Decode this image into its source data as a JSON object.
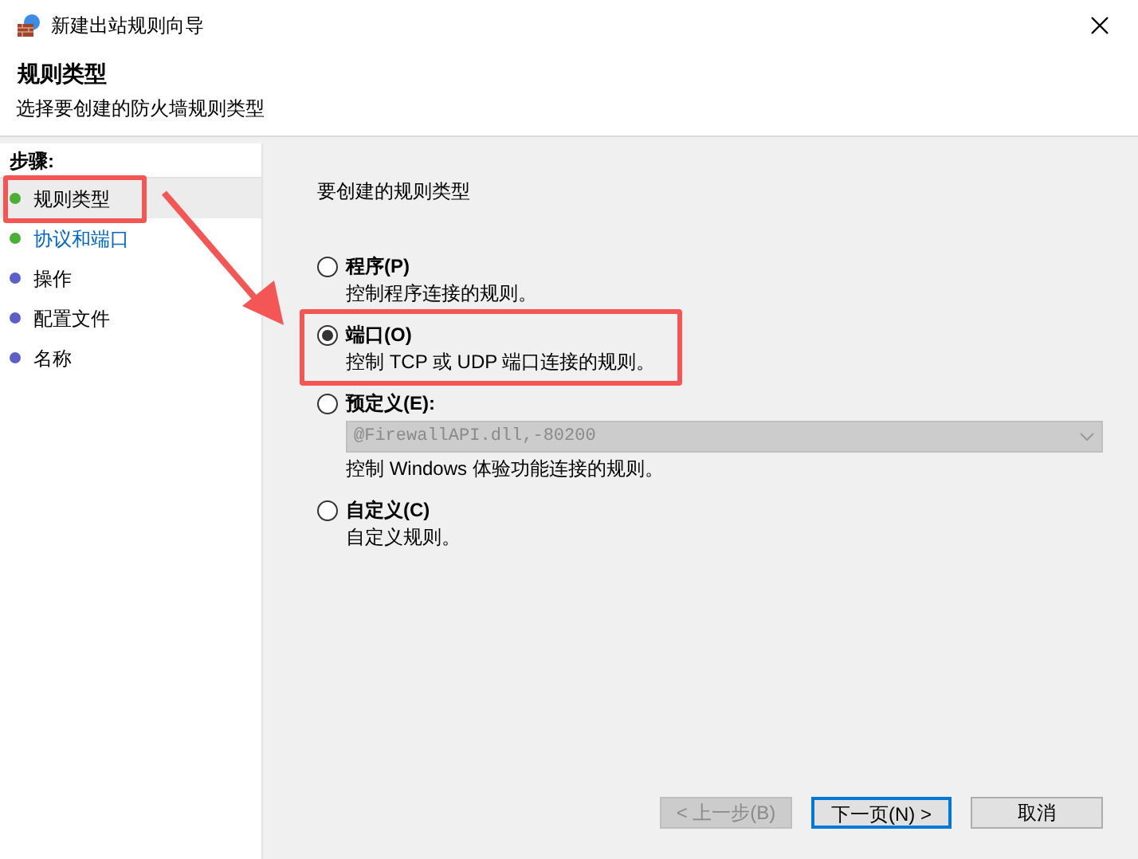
{
  "window": {
    "title": "新建出站规则向导"
  },
  "header": {
    "title": "规则类型",
    "subtitle": "选择要创建的防火墙规则类型"
  },
  "steps": {
    "title": "步骤:",
    "items": [
      {
        "label": "规则类型",
        "selected": true,
        "link": false,
        "color": "#4caf35"
      },
      {
        "label": "协议和端口",
        "selected": false,
        "link": true,
        "color": "#4caf35"
      },
      {
        "label": "操作",
        "selected": false,
        "link": false,
        "color": "#5b5fc7"
      },
      {
        "label": "配置文件",
        "selected": false,
        "link": false,
        "color": "#5b5fc7"
      },
      {
        "label": "名称",
        "selected": false,
        "link": false,
        "color": "#5b5fc7"
      }
    ]
  },
  "prompt": "要创建的规则类型",
  "options": [
    {
      "label": "程序(P)",
      "description": "控制程序连接的规则。",
      "selected": false
    },
    {
      "label": "端口(O)",
      "description": "控制 TCP 或 UDP 端口连接的规则。",
      "selected": true
    },
    {
      "label": "预定义(E):",
      "description": "控制 Windows 体验功能连接的规则。",
      "selected": false,
      "dropdown": {
        "value": "@FirewallAPI.dll,-80200",
        "disabled": true
      }
    },
    {
      "label": "自定义(C)",
      "description": "自定义规则。",
      "selected": false
    }
  ],
  "buttons": [
    {
      "label": "< 上一步(B)",
      "disabled": true,
      "default": false
    },
    {
      "label": "下一页(N) >",
      "disabled": false,
      "default": true
    },
    {
      "label": "取消",
      "disabled": false,
      "default": false
    }
  ]
}
